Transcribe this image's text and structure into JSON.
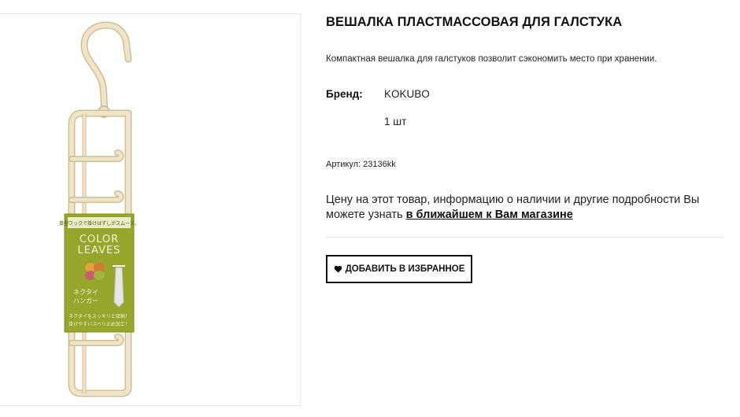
{
  "product": {
    "title": "ВЕШАЛКА ПЛАСТМАССОВАЯ ДЛЯ ГАЛСТУКА",
    "description": "Компактная вешалка для галстуков позволит сэкономить место при хранении.",
    "brand_label": "Бренд:",
    "brand_value": "KOKUBO",
    "quantity": "1 шт",
    "sku": "Артикул: 23136kk",
    "price_info_text": "Цену на этот товар, информацию о наличии и другие подробности Вы можете узнать",
    "price_info_link": "в ближайшем к Вам магазине",
    "favorite_button_label": "ДОБАВИТЬ В ИЗБРАННОЕ",
    "favorite_icon": "heart-icon"
  },
  "packaging": {
    "top_line": "掛型フックで掛けはずしがスムーズ。",
    "brand_line1": "COLOR",
    "brand_line2": "LEAVES",
    "product_jp1": "ネクタイ",
    "product_jp2": "ハンガー",
    "bottom_line1": "ネクタイをスッキリと収納！",
    "bottom_line2": "掛けやすいスベリ止め加工！"
  },
  "colors": {
    "hanger": "#efe4c6",
    "hanger_outline": "#cdbf9a",
    "label_green": "#95a62a",
    "text_dark": "#111111"
  }
}
